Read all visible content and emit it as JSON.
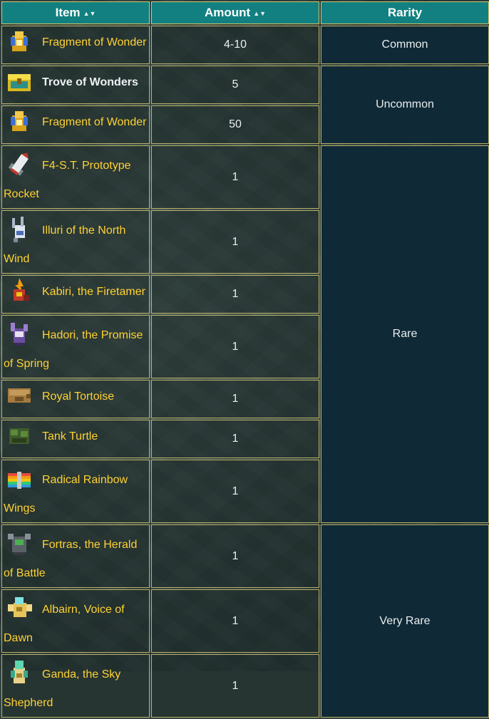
{
  "headers": {
    "item": "Item",
    "amount": "Amount",
    "rarity": "Rarity"
  },
  "rows": [
    {
      "name": "Fragment of Wonder",
      "amount": "4-10",
      "icon": "fragment-of-wonder-icon"
    },
    {
      "name": "Trove of Wonders",
      "amount": "5",
      "icon": "trove-of-wonders-icon"
    },
    {
      "name": "Fragment of Wonder",
      "amount": "50",
      "icon": "fragment-of-wonder-icon"
    },
    {
      "name": "F4-S.T. Prototype Rocket",
      "amount": "1",
      "icon": "rocket-mount-icon"
    },
    {
      "name": "Illuri of the North Wind",
      "amount": "1",
      "icon": "illuri-icon"
    },
    {
      "name": "Kabiri, the Firetamer",
      "amount": "1",
      "icon": "kabiri-icon"
    },
    {
      "name": "Hadori, the Promise of Spring",
      "amount": "1",
      "icon": "hadori-icon"
    },
    {
      "name": "Royal Tortoise",
      "amount": "1",
      "icon": "royal-tortoise-icon"
    },
    {
      "name": "Tank Turtle",
      "amount": "1",
      "icon": "tank-turtle-icon"
    },
    {
      "name": "Radical Rainbow Wings",
      "amount": "1",
      "icon": "rainbow-wings-icon"
    },
    {
      "name": "Fortras, the Herald of Battle",
      "amount": "1",
      "icon": "fortras-icon"
    },
    {
      "name": "Albairn, Voice of Dawn",
      "amount": "1",
      "icon": "albairn-icon"
    },
    {
      "name": "Ganda, the Sky Shepherd",
      "amount": "1",
      "icon": "ganda-icon"
    }
  ],
  "rarity": {
    "common": "Common",
    "uncommon": "Uncommon",
    "rare": "Rare",
    "very_rare": "Very Rare"
  }
}
